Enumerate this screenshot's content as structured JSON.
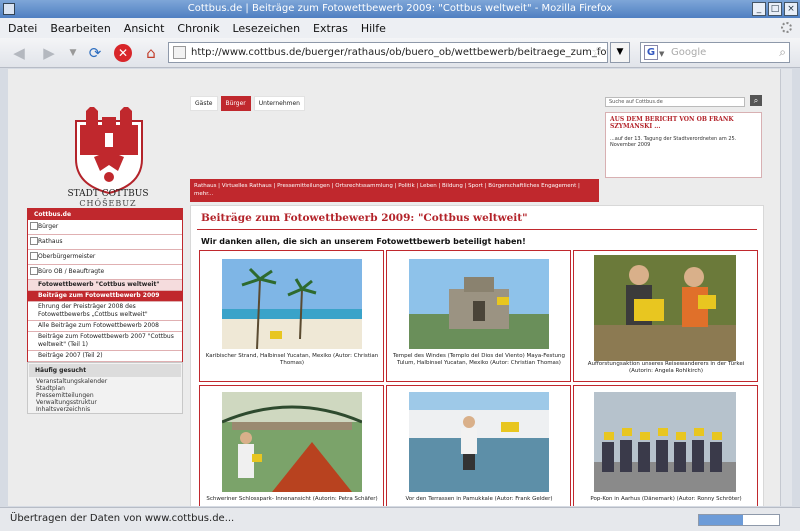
{
  "window": {
    "title": "Cottbus.de | Beiträge zum Fotowettbewerb 2009: \"Cottbus weltweit\" - Mozilla Firefox"
  },
  "menu": [
    "Datei",
    "Bearbeiten",
    "Ansicht",
    "Chronik",
    "Lesezeichen",
    "Extras",
    "Hilfe"
  ],
  "nav": {
    "url": "http://www.cottbus.de/buerger/rathaus/ob/buero_ob/wettbewerb/beitraege_zum_fotowettbewerb",
    "search_placeholder": "Google"
  },
  "status": {
    "text": "Übertragen der Daten von www.cottbus.de..."
  },
  "site": {
    "city_name": "STADT COTTBUS",
    "city_sub": "CHÓŠEBUZ",
    "tabs": [
      "Gäste",
      "Bürger",
      "Unternehmen"
    ],
    "search_placeholder": "Suche auf Cottbus.de",
    "news": {
      "headline": "AUS DEM BERICHT VON OB FRANK SZYMANSKI ...",
      "text": "...auf der 13. Tagung der Stadtverordneten am 25. November 2009"
    },
    "rednav": "Rathaus | Virtuelles Rathaus | Pressemitteilungen | Ortsrechtssammlung | Politik | Leben | Bildung | Sport | Bürgerschaftliches Engagement | mehr...",
    "leftnav": {
      "header": "Cottbus.de",
      "items": [
        "Bürger",
        "Rathaus",
        "Oberbürgermeister",
        "Büro OB / Beauftragte",
        "Fotowettbewerb \"Cottbus weltweit\"",
        "Beiträge zum Fotowettbewerb 2009",
        "Ehrung der Preisträger 2008 des Fotowettbewerbs „Cottbus weltweit\"",
        "Alle Beiträge zum Fotowettbewerb 2008",
        "Beiträge zum Fotowettbewerb 2007 \"Cottbus weltweit\" (Teil 1)",
        "Beiträge 2007 (Teil 2)"
      ]
    },
    "quick": {
      "header": "Häufig gesucht",
      "items": [
        "Veranstaltungskalender",
        "Stadtplan",
        "Pressemitteilungen",
        "Verwaltungsstruktur",
        "Inhaltsverzeichnis"
      ]
    },
    "page_title": "Beiträge zum Fotowettbewerb 2009: \"Cottbus weltweit\"",
    "intro": "Wir danken allen, die sich an unserem Fotowettbewerb beteiligt haben!",
    "photos": [
      {
        "caption": "Karibischer Strand, Halbinsel Yucatan, Mexiko (Autor: Christian Thomas)"
      },
      {
        "caption": "Tempel des Windes (Templo del Dios del Viento) Maya-Festung Tulum, Halbinsel Yucatan, Mexiko (Autor: Christian Thomas)"
      },
      {
        "caption": "Aufforstungsaktion unseres Reisewanderers in der Türkei (Autorin: Angela Rohlkirch)"
      },
      {
        "caption": "Schweriner Schlosspark- Innenansicht (Autorin: Petra Schäfer)"
      },
      {
        "caption": "Vor den Terrassen in Pamukkale (Autor: Frank Gelder)"
      },
      {
        "caption": "Pop-Kon in Aarhus (Dänemark) (Autor: Ronny Schröter)"
      }
    ]
  }
}
